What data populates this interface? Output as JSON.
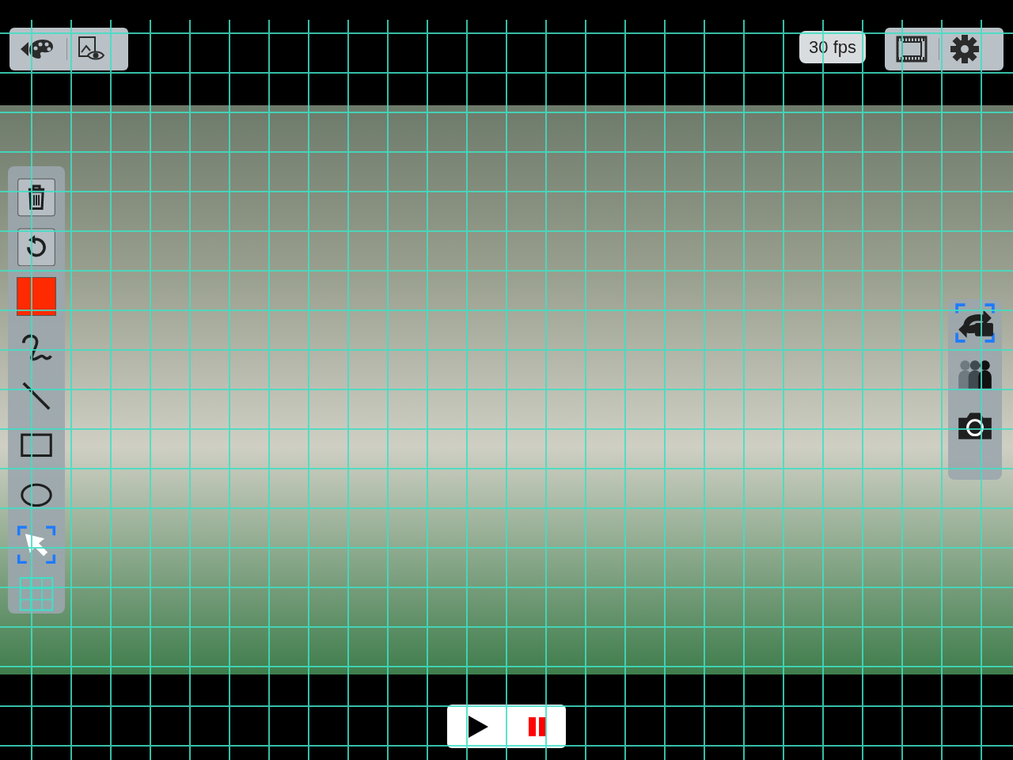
{
  "top_bar": {
    "fps": "30 fps"
  },
  "grid": {
    "on": true
  },
  "tools": [
    {
      "kind": "trash",
      "selected": false
    },
    {
      "kind": "undo",
      "selected": false
    },
    {
      "kind": "color",
      "color": "#ff2a00"
    },
    {
      "kind": "freehand",
      "selected": false
    },
    {
      "kind": "line",
      "selected": false
    },
    {
      "kind": "rectangle",
      "selected": false
    },
    {
      "kind": "ellipse",
      "selected": false
    },
    {
      "kind": "pointer",
      "selected": true
    },
    {
      "kind": "grid",
      "selected": false
    }
  ],
  "side_tools": [
    {
      "kind": "switch-camera",
      "selected": true
    },
    {
      "kind": "people",
      "selected": false
    },
    {
      "kind": "camera",
      "selected": false
    }
  ]
}
